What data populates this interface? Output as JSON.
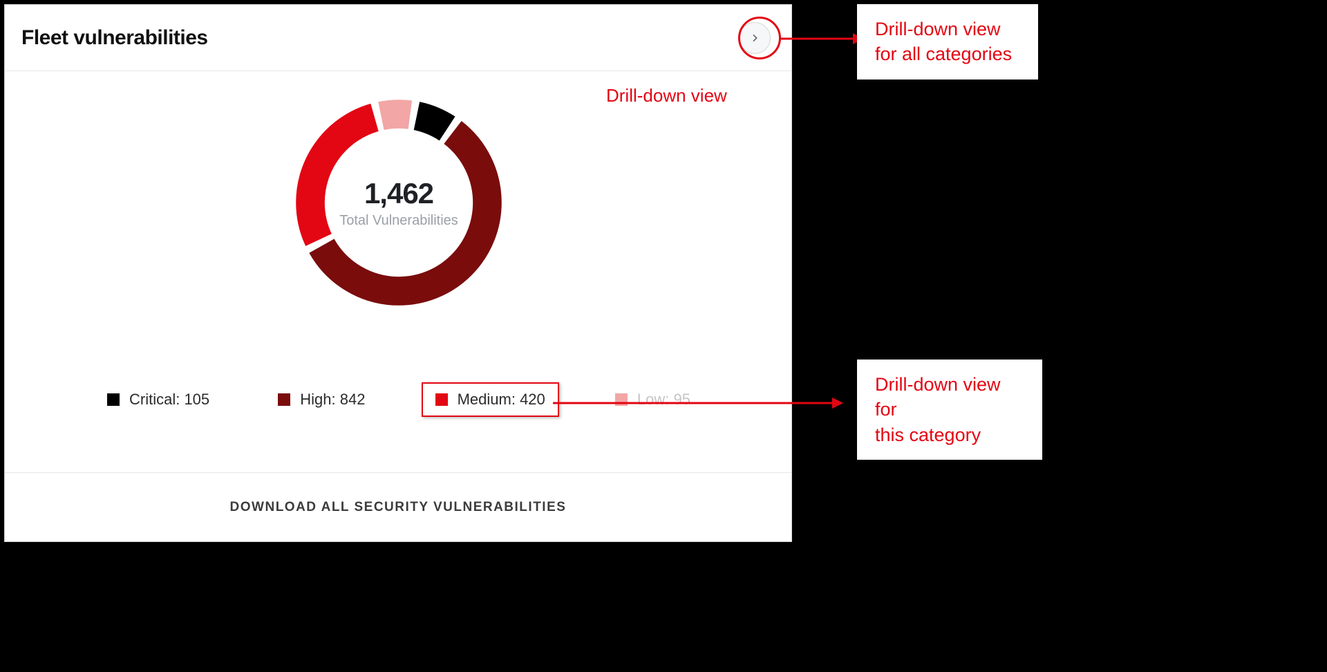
{
  "card": {
    "title": "Fleet vulnerabilities",
    "total_value": "1,462",
    "total_label": "Total Vulnerabilities",
    "download_label": "DOWNLOAD ALL SECURITY VULNERABILITIES"
  },
  "legend": [
    {
      "name": "Critical",
      "value": 105,
      "display": "Critical: 105",
      "color": "#000000"
    },
    {
      "name": "High",
      "value": 842,
      "display": "High: 842",
      "color": "#7a0c0c"
    },
    {
      "name": "Medium",
      "value": 420,
      "display": "Medium: 420",
      "color": "#e30613"
    },
    {
      "name": "Low",
      "value": 95,
      "display": "Low: 95",
      "color": "#f2a6a6"
    }
  ],
  "annotations": {
    "inline": "Drill-down view",
    "callout_top": "Drill-down view\nfor all categories",
    "callout_bottom": "Drill-down view for\nthis category"
  },
  "chart_data": {
    "type": "pie",
    "title": "Fleet vulnerabilities",
    "categories": [
      "Critical",
      "High",
      "Medium",
      "Low"
    ],
    "values": [
      105,
      842,
      420,
      95
    ],
    "colors": [
      "#000000",
      "#7a0c0c",
      "#e30613",
      "#f2a6a6"
    ],
    "total": 1462,
    "total_label": "Total Vulnerabilities",
    "donut": true
  }
}
